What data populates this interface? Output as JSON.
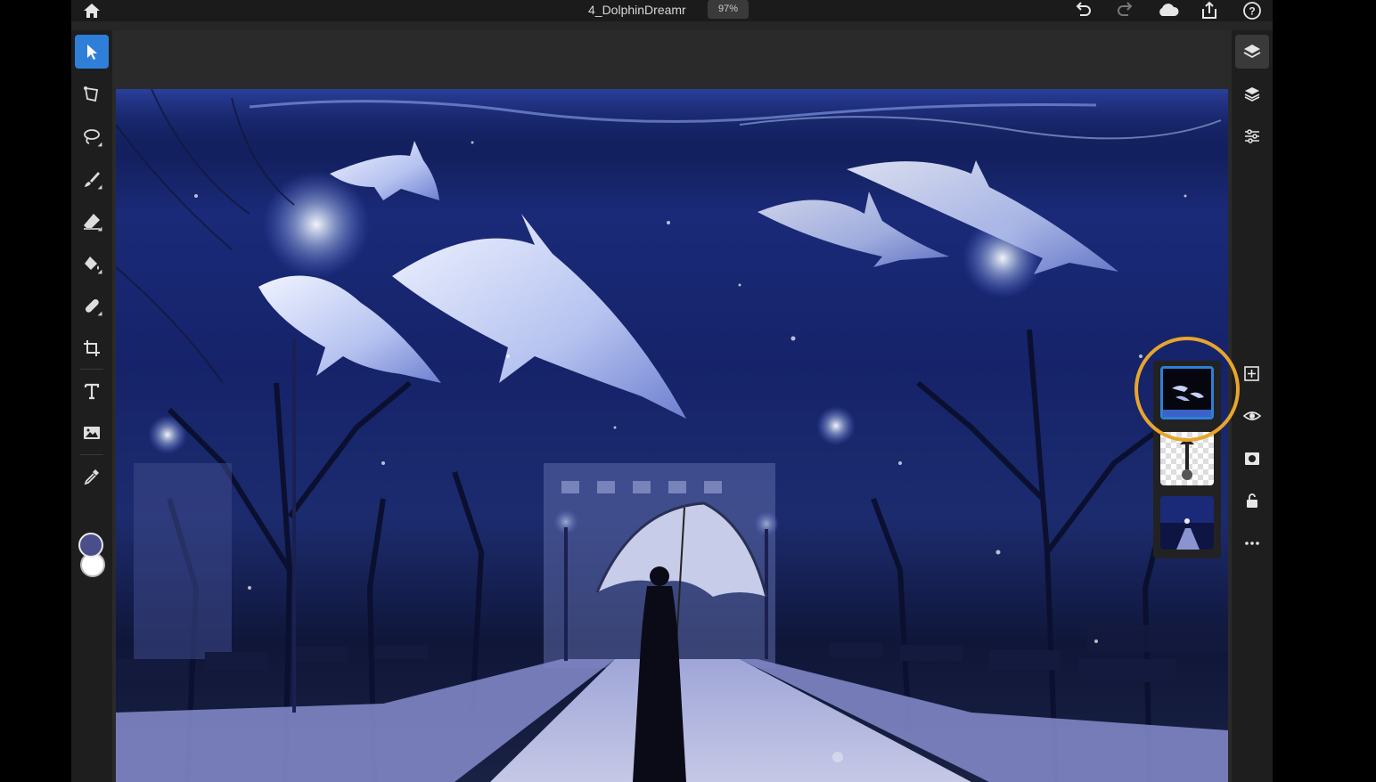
{
  "document": {
    "title": "4_DolphinDreamr",
    "zoom": "97%"
  },
  "topbar": {
    "icons": [
      "home-icon",
      "undo-icon",
      "redo-icon",
      "cloud-icon",
      "share-icon",
      "help-icon"
    ]
  },
  "toolbar": {
    "tools": [
      "select-tool",
      "transform-tool",
      "lasso-tool",
      "brush-tool",
      "eraser-tool",
      "fill-tool",
      "healing-tool",
      "crop-tool",
      "type-tool",
      "place-image-tool",
      "eyedropper-tool"
    ],
    "active_tool": "select-tool",
    "foreground_color": "#4a4f8c",
    "background_color": "#ffffff"
  },
  "rightbar": {
    "tools": [
      "layers-icon",
      "layer-properties-icon",
      "adjustments-icon",
      "add-layer-icon",
      "visibility-icon",
      "mask-icon",
      "lock-icon",
      "more-icon"
    ]
  },
  "layers": [
    {
      "name": "dolphins-layer",
      "selected": true
    },
    {
      "name": "woman-umbrella-layer",
      "selected": false
    },
    {
      "name": "background-layer",
      "selected": false
    }
  ],
  "colors": {
    "accent": "#2f7fd8",
    "highlight": "#e8a52c",
    "panel": "#1e1e1e"
  }
}
